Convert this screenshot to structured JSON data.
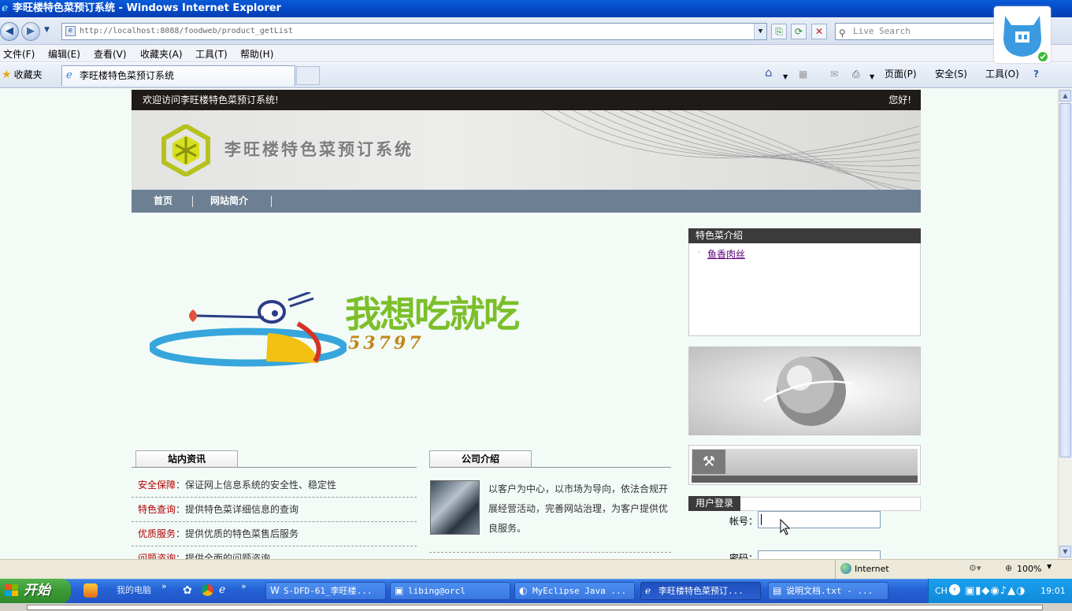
{
  "window": {
    "title": "李旺楼特色菜预订系统 - Windows Internet Explorer"
  },
  "address_bar": {
    "url": "http://localhost:8088/foodweb/product_getList"
  },
  "search": {
    "placeholder": "Live Search"
  },
  "menu": [
    "文件(F)",
    "编辑(E)",
    "查看(V)",
    "收藏夹(A)",
    "工具(T)",
    "帮助(H)"
  ],
  "favorites_label": "收藏夹",
  "tab": {
    "title": "李旺楼特色菜预订系统"
  },
  "command_bar": {
    "page": "页面(P)",
    "safety": "安全(S)",
    "tools": "工具(O)"
  },
  "page": {
    "welcome": "欢迎访问李旺楼特色菜预订系统!",
    "greeting": "您好!",
    "site_name": "李旺楼特色菜预订系统",
    "nav": [
      "首页",
      "网站简介"
    ],
    "promo": {
      "slogan": "我想吃就吃",
      "number": "53797"
    },
    "news": {
      "title": "站内资讯",
      "items": [
        {
          "key": "安全保障",
          "text": "保证网上信息系统的安全性、稳定性"
        },
        {
          "key": "特色查询",
          "text": "提供特色菜详细信息的查询"
        },
        {
          "key": "优质服务",
          "text": "提供优质的特色菜售后服务"
        },
        {
          "key": "问题咨询",
          "text": "提供全面的问题咨询"
        }
      ]
    },
    "company": {
      "title": "公司介绍",
      "text": "以客户为中心，以市场为导向，依法合规开展经营活动，完善网站治理，为客户提供优良服务。"
    },
    "specialty": {
      "title": "特色菜介绍",
      "items": [
        "鱼香肉丝"
      ]
    },
    "login": {
      "title": "用户登录",
      "account_label": "帐号：",
      "password_label": "密码："
    }
  },
  "statusbar": {
    "zone": "Internet",
    "zoom": "100%"
  },
  "taskbar": {
    "start": "开始",
    "quick_launch_label": "我的电脑",
    "tasks": [
      {
        "label": "S-DFD-61_李旺楼...",
        "active": false
      },
      {
        "label": "libing@orcl",
        "active": false
      },
      {
        "label": "MyEclipse Java ...",
        "active": false
      },
      {
        "label": "李旺楼特色菜预订...",
        "active": true
      },
      {
        "label": "说明文档.txt - ...",
        "active": false
      }
    ],
    "lang": "CH",
    "clock": "19:01"
  },
  "colors": {
    "welcome_bar": "#1e1b18",
    "nav_bar": "#6c7f93",
    "box_head": "#3b3b3b",
    "news_key": "#b10000",
    "title_bar": "#0347c4"
  }
}
